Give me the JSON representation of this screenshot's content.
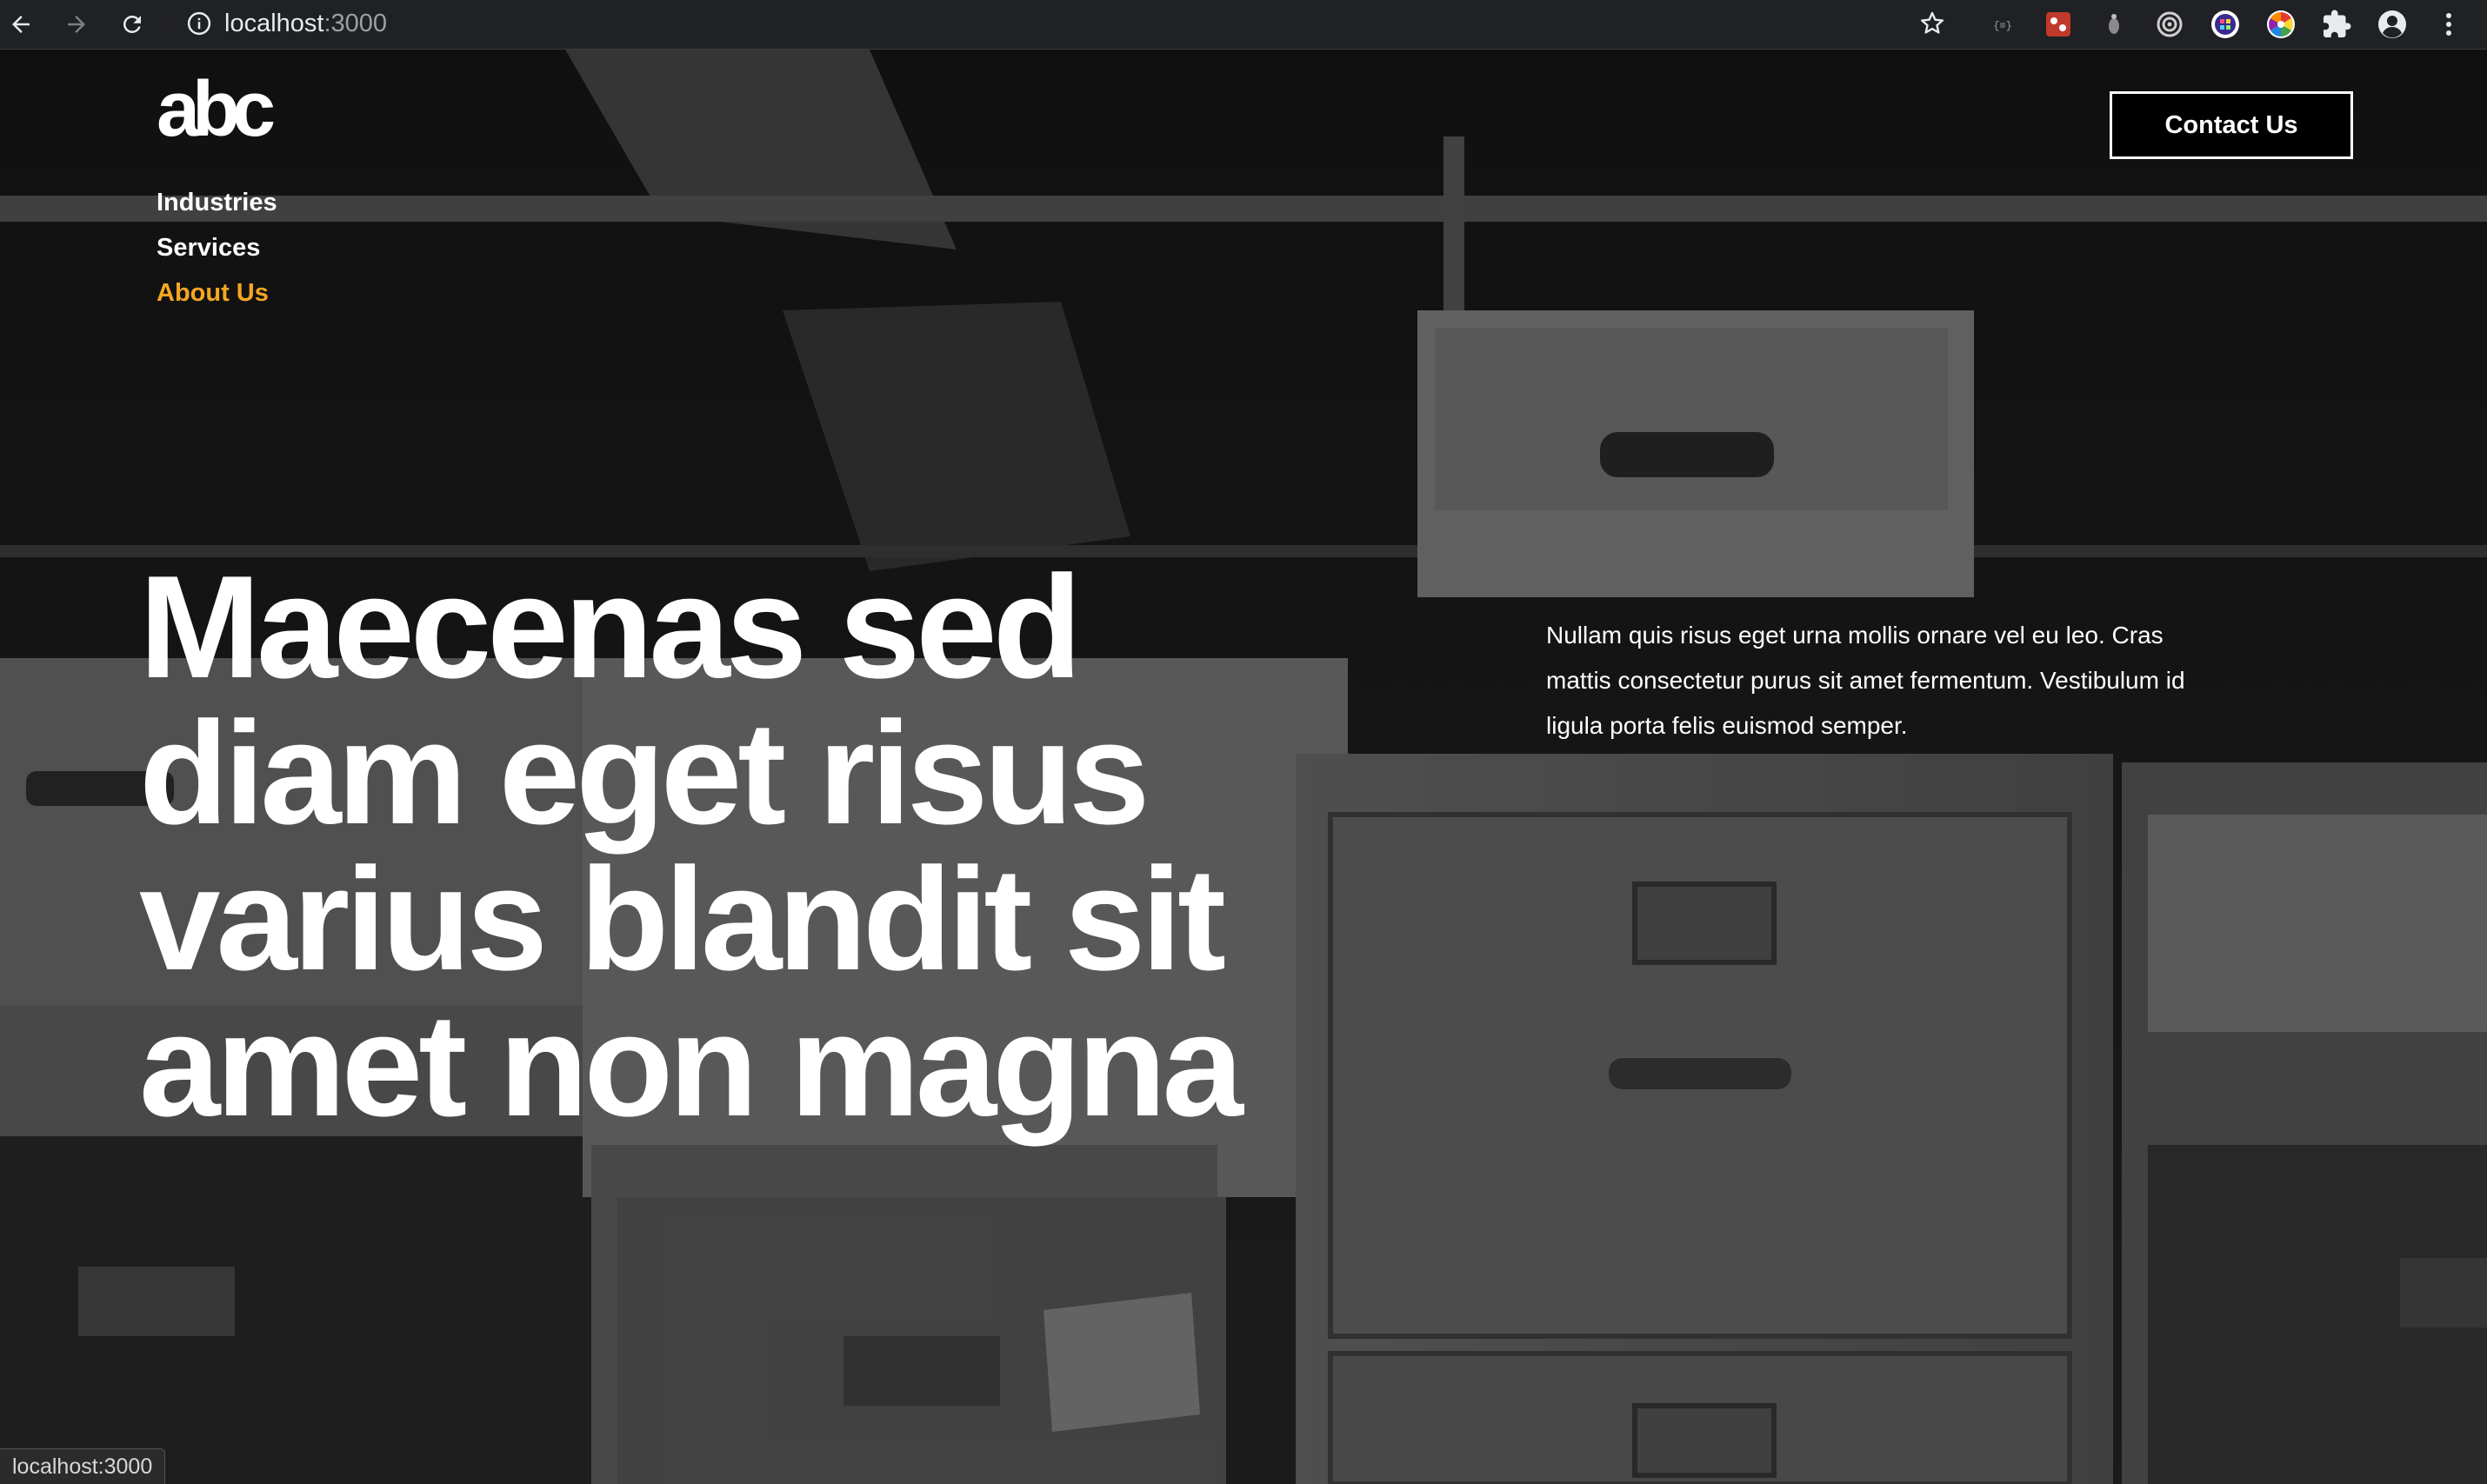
{
  "browser": {
    "url_host": "localhost",
    "url_port": ":3000",
    "status_url": "localhost:3000",
    "icons": [
      "back-icon",
      "forward-icon",
      "reload-icon",
      "site-info-icon",
      "bookmark-star-icon",
      "json-viewer-icon",
      "red-extension-icon",
      "gray-extension-icon",
      "target-extension-icon",
      "purple-extension-icon",
      "color-wheel-extension-icon",
      "puzzle-icon",
      "profile-icon",
      "kebab-menu-icon"
    ]
  },
  "site": {
    "logo": "abc",
    "nav": [
      {
        "label": "Industries"
      },
      {
        "label": "Services"
      },
      {
        "label": "About Us"
      }
    ],
    "active_nav": "About Us",
    "contact_label": "Contact Us",
    "hero_title": "Maecenas sed diam eget risus varius blandit sit amet non magna",
    "hero_text": "Nullam quis risus eget urna mollis ornare vel eu leo. Cras mattis consectetur purus sit amet fermentum. Vestibulum id ligula porta felis euismod semper."
  },
  "colors": {
    "active_nav": "#f5a623",
    "chrome_bg": "#202124",
    "text": "#ffffff"
  }
}
